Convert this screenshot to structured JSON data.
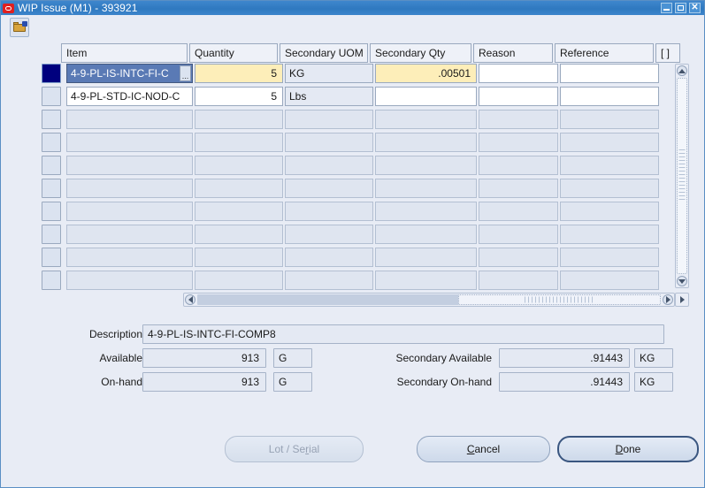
{
  "window": {
    "title": "WIP Issue (M1) - 393921",
    "logo_icon": "oracle-logo-icon",
    "controls": {
      "minimize": "minimize-icon",
      "maximize": "maximize-icon",
      "close": "close-icon"
    }
  },
  "toolbar": {
    "folder_icon": "open-folder-icon"
  },
  "grid": {
    "columns": [
      {
        "label": "Item"
      },
      {
        "label": "Quantity"
      },
      {
        "label": "Secondary UOM"
      },
      {
        "label": "Secondary Qty"
      },
      {
        "label": "Reason"
      },
      {
        "label": "Reference"
      },
      {
        "label": "[ ]"
      }
    ],
    "rows": [
      {
        "selected": true,
        "item": "4-9-PL-IS-INTC-FI-C",
        "lov": "...",
        "quantity": "5",
        "secondary_uom": "KG",
        "secondary_qty": ".00501",
        "reason": "",
        "reference": ""
      },
      {
        "selected": false,
        "item": "4-9-PL-STD-IC-NOD-C",
        "quantity": "5",
        "secondary_uom": "Lbs",
        "secondary_qty": "",
        "reason": "",
        "reference": ""
      }
    ],
    "empty_row_count": 8
  },
  "form": {
    "description_label": "Description",
    "description_value": "4-9-PL-IS-INTC-FI-COMP8",
    "available_label": "Available",
    "available_value": "913",
    "available_uom": "G",
    "onhand_label": "On-hand",
    "onhand_value": "913",
    "onhand_uom": "G",
    "secondary_available_label": "Secondary Available",
    "secondary_available_value": ".91443",
    "secondary_available_uom": "KG",
    "secondary_onhand_label": "Secondary On-hand",
    "secondary_onhand_value": ".91443",
    "secondary_onhand_uom": "KG"
  },
  "buttons": {
    "lot_serial": "Lot / Serial",
    "cancel": "Cancel",
    "done": "Done"
  },
  "colors": {
    "titlebar": "#2f79c0",
    "background": "#e8ecf5",
    "selected_row": "#00007e",
    "required_field": "#fdeeb9",
    "selected_cell": "#5a7ab5"
  }
}
